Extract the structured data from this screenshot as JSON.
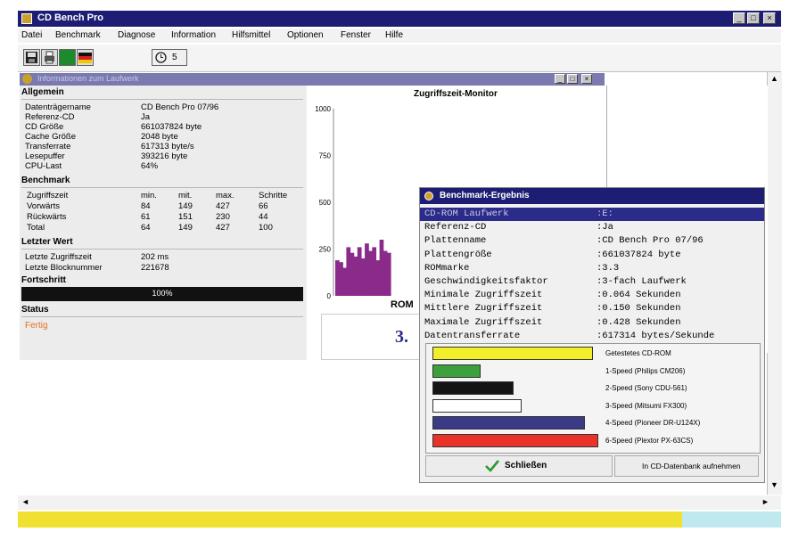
{
  "app": {
    "title": "CD Bench Pro",
    "controls": [
      "_",
      "□",
      "×"
    ]
  },
  "menu": [
    "Datei",
    "Benchmark",
    "Diagnose",
    "Information",
    "Hilfsmittel",
    "Optionen",
    "Fenster",
    "Hilfe"
  ],
  "toolbar": {
    "counter": "5"
  },
  "inner_window": {
    "title": "Informationen zum Laufwerk",
    "controls": [
      "_",
      "□",
      "×"
    ]
  },
  "allgemein": {
    "heading": "Allgemein",
    "rows": [
      {
        "k": "Datenträgername",
        "v": "CD Bench Pro 07/96"
      },
      {
        "k": "Referenz-CD",
        "v": "Ja"
      },
      {
        "k": "CD Größe",
        "v": "661037824 byte"
      },
      {
        "k": "Cache Größe",
        "v": "2048 byte"
      },
      {
        "k": "Transferrate",
        "v": "617313 byte/s"
      },
      {
        "k": "Lesepuffer",
        "v": "393216 byte"
      },
      {
        "k": "CPU-Last",
        "v": "64%"
      }
    ]
  },
  "benchmark": {
    "heading": "Benchmark",
    "headers": [
      "Zugriffszeit",
      "min.",
      "mit.",
      "max.",
      "Schritte"
    ],
    "rows": [
      [
        "Vorwärts",
        "84",
        "149",
        "427",
        "66"
      ],
      [
        "Rückwärts",
        "61",
        "151",
        "230",
        "44"
      ],
      [
        "Total",
        "64",
        "149",
        "427",
        "100"
      ]
    ]
  },
  "letzter": {
    "heading": "Letzter Wert",
    "rows": [
      {
        "k": "Letzte Zugriffszeit",
        "v": "202 ms"
      },
      {
        "k": "Letzte Blocknummer",
        "v": "221678"
      }
    ]
  },
  "fortschritt": {
    "heading": "Fortschritt",
    "value": "100%",
    "fraction": 1.0
  },
  "status": {
    "heading": "Status",
    "text": "Fertig"
  },
  "monitor": {
    "title": "Zugriffszeit-Monitor",
    "footer": "ROM",
    "y_ticks": [
      "1000",
      "750",
      "500",
      "250",
      "0"
    ]
  },
  "chart_data": {
    "type": "bar",
    "title": "Zugriffszeit-Monitor",
    "ylim": [
      0,
      1000
    ],
    "yticks": [
      1000,
      750,
      500,
      250,
      0
    ],
    "values": [
      190,
      180,
      150,
      260,
      230,
      210,
      260,
      200,
      280,
      240,
      260,
      190,
      300,
      240,
      230
    ],
    "color": "#8a2b8a"
  },
  "dialog": {
    "title": "Benchmark-Ergebnis",
    "rows": [
      {
        "k": "CD-ROM Laufwerk",
        "v": ":E:",
        "selected": true
      },
      {
        "k": "Referenz-CD",
        "v": ":Ja"
      },
      {
        "k": "Plattenname",
        "v": ":CD Bench Pro 07/96"
      },
      {
        "k": "Plattengröße",
        "v": ":661037824 byte"
      },
      {
        "k": "ROMmarke",
        "v": ":3.3"
      },
      {
        "k": "Geschwindigkeitsfaktor",
        "v": ":3-fach Laufwerk"
      },
      {
        "k": "Minimale Zugriffszeit",
        "v": ":0.064 Sekunden"
      },
      {
        "k": "Mittlere Zugriffszeit",
        "v": ":0.150 Sekunden"
      },
      {
        "k": "Maximale Zugriffszeit",
        "v": ":0.428 Sekunden"
      },
      {
        "k": "Datentransferrate",
        "v": ":617314 bytes/Sekunde"
      }
    ],
    "marker": "3.",
    "comparison": [
      {
        "label": "Getestetes CD-ROM",
        "value": 0.97,
        "color": "#f2ee2a"
      },
      {
        "label": "1-Speed (Philips CM206)",
        "value": 0.29,
        "color": "#3ca03c"
      },
      {
        "label": "2-Speed (Sony CDU-561)",
        "value": 0.49,
        "color": "#141414"
      },
      {
        "label": "3-Speed (Mitsumi FX300)",
        "value": 0.54,
        "color": "#ffffff"
      },
      {
        "label": "4-Speed (Pioneer DR-U124X)",
        "value": 0.92,
        "color": "#3a3a86"
      },
      {
        "label": "6-Speed (Plextor PX-63CS)",
        "value": 1.0,
        "color": "#e8322a"
      }
    ],
    "close_label": "Schließen",
    "db_label": "In CD-Datenbank aufnehmen"
  },
  "bottom_progress": {
    "fraction": 0.87
  }
}
